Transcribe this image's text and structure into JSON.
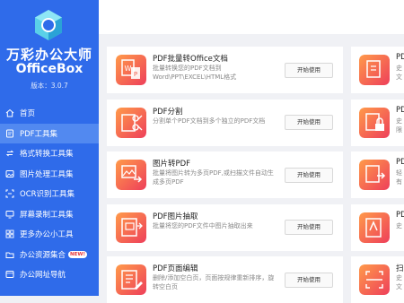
{
  "app": {
    "title": "万彩办公大师",
    "subtitle": "OfficeBox",
    "version": "版本：3.0.7"
  },
  "sidebar": {
    "items": [
      {
        "label": "首页",
        "icon": "home-icon"
      },
      {
        "label": "PDF工具集",
        "icon": "pdf-tools-icon",
        "active": true
      },
      {
        "label": "格式转换工具集",
        "icon": "format-convert-icon"
      },
      {
        "label": "图片处理工具集",
        "icon": "image-tools-icon"
      },
      {
        "label": "OCR识别工具集",
        "icon": "ocr-icon"
      },
      {
        "label": "屏幕录制工具集",
        "icon": "screen-record-icon"
      },
      {
        "label": "更多办公小工具",
        "icon": "more-tools-icon"
      },
      {
        "label": "办公资源集合",
        "icon": "resources-icon",
        "badge": "NEW!"
      },
      {
        "label": "办公网址导航",
        "icon": "url-nav-icon"
      }
    ]
  },
  "tools": [
    {
      "title": "PDF批量转Office文档",
      "desc": "批量转换您的PDF文档到Word\\PPT\\EXCEL\\HTML格式",
      "button": "开始使用",
      "icon": "pdf-to-office-icon"
    },
    {
      "title": "PDF分割",
      "desc": "分割单个PDF文档到多个独立的PDF文档",
      "button": "开始使用",
      "icon": "pdf-split-icon"
    },
    {
      "title": "图片转PDF",
      "desc": "批量将图片转为多页PDF,或扫描文件自动生成多页PDF",
      "button": "开始使用",
      "icon": "image-to-pdf-icon"
    },
    {
      "title": "PDF图片抽取",
      "desc": "批量将您的PDF文件中图片抽取出来",
      "button": "开始使用",
      "icon": "pdf-image-extract-icon"
    },
    {
      "title": "PDF页面编辑",
      "desc": "删除/添加空白页，页面按规律重新排序，旋转空白页",
      "button": "开始使用",
      "icon": "pdf-page-edit-icon"
    }
  ],
  "tools_right": [
    {
      "title": "PD",
      "desc": "史文",
      "icon": "pdf-merge-icon"
    },
    {
      "title": "PD",
      "desc": "史限",
      "icon": "pdf-lock-icon"
    },
    {
      "title": "PD",
      "desc": "轻有",
      "icon": "pdf-convert-icon"
    },
    {
      "title": "PD",
      "desc": "史",
      "icon": "pdf-doc-icon"
    },
    {
      "title": "扫",
      "desc": "史文",
      "icon": "scan-icon"
    }
  ],
  "colors": {
    "sidebar": "#2f6bea",
    "sidebar_active": "#5289f0",
    "icon_gradient_start": "#ff9a4a",
    "icon_gradient_end": "#ee3f5a",
    "accent_red": "#e8373a"
  }
}
